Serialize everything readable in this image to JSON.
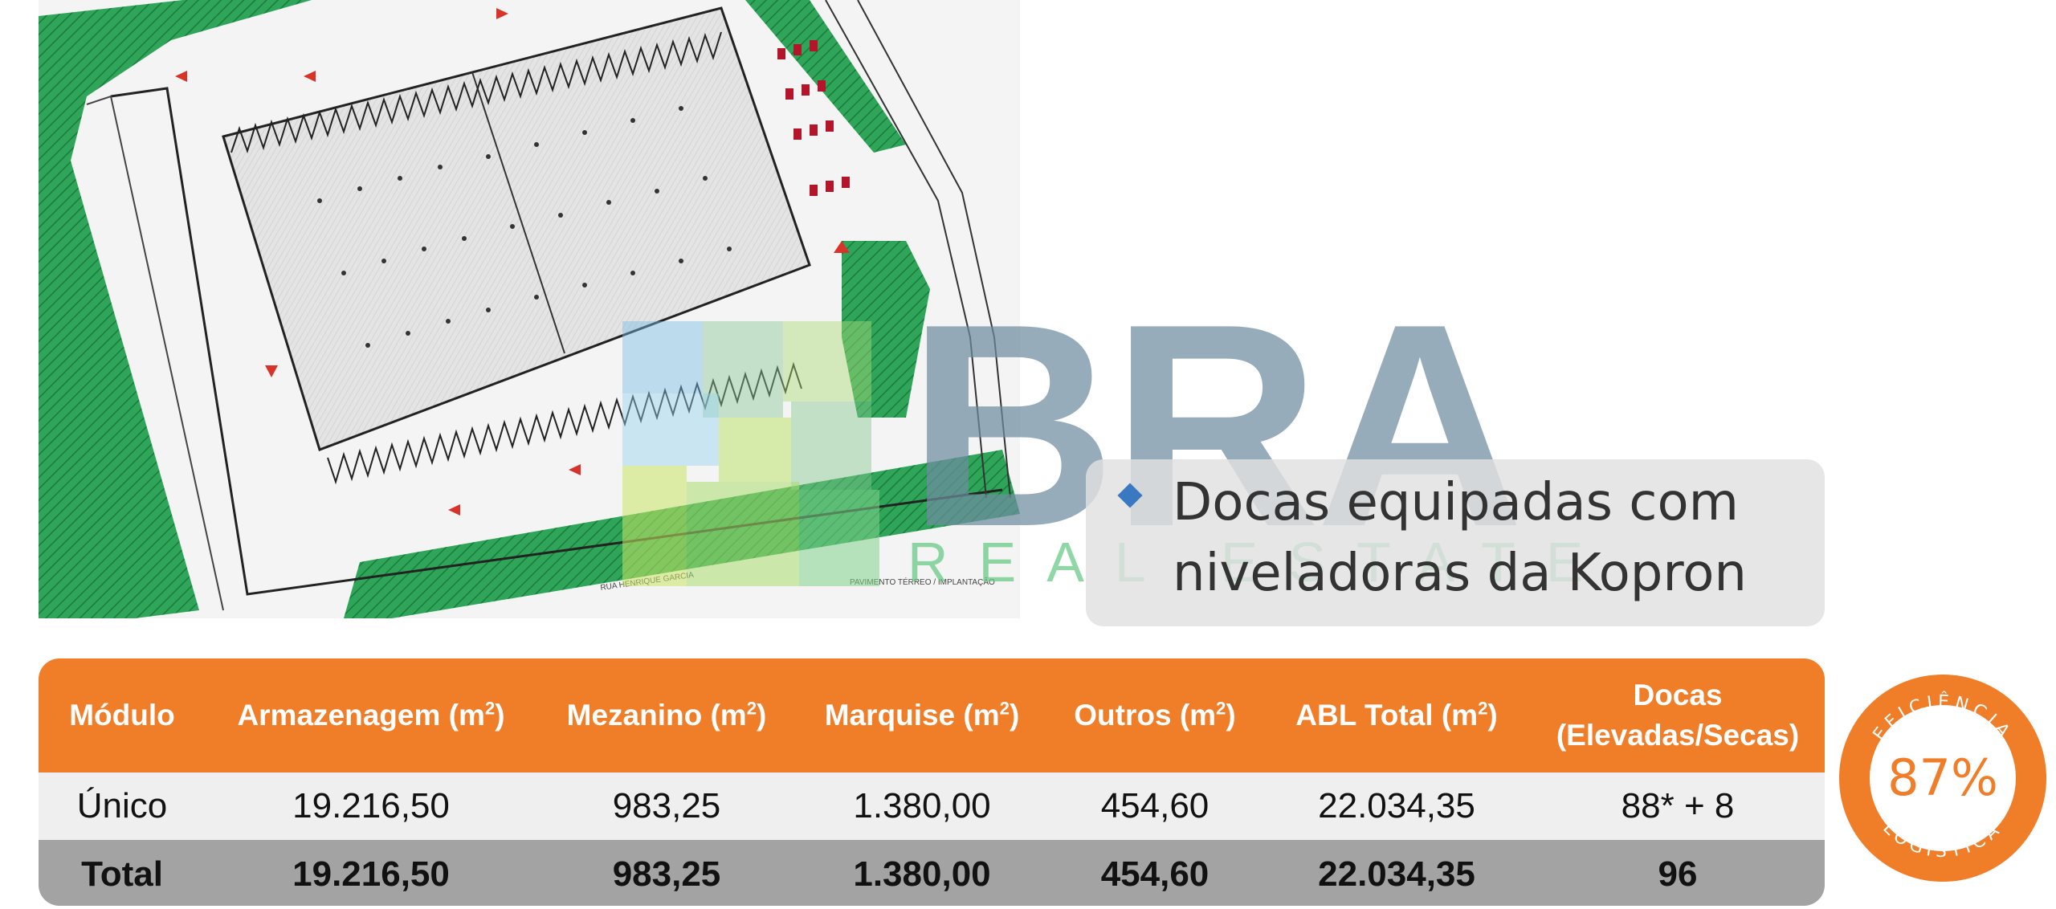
{
  "plan": {
    "street_label": "RUA HENRIQUE GARCIA",
    "caption": "PAVIMENTO TÉRREO / IMPLANTAÇÃO"
  },
  "watermark": {
    "letters": "BRA",
    "sub": "REAL ESTATE"
  },
  "callout": {
    "text": "Docas equipadas com niveladoras da Kopron",
    "bullet_color": "#3a79c2"
  },
  "table": {
    "header_color": "#f07d28",
    "headers": {
      "modulo": "Módulo",
      "armazenagem": "Armazenagem (m",
      "mezanino": "Mezanino (m",
      "marquise": "Marquise (m",
      "outros": "Outros (m",
      "abl": "ABL Total (m",
      "sup": "2",
      "paren": ")",
      "docas_l1": "Docas",
      "docas_l2": "(Elevadas/Secas)"
    },
    "rows": [
      {
        "modulo": "Único",
        "armazenagem": "19.216,50",
        "mezanino": "983,25",
        "marquise": "1.380,00",
        "outros": "454,60",
        "abl": "22.034,35",
        "docas": "88* + 8"
      },
      {
        "modulo": "Total",
        "armazenagem": "19.216,50",
        "mezanino": "983,25",
        "marquise": "1.380,00",
        "outros": "454,60",
        "abl": "22.034,35",
        "docas": "96"
      }
    ]
  },
  "badge": {
    "value": "87%",
    "top_text": "EFICIÊNCIA",
    "bottom_text": "LOGÍSTICA",
    "color": "#f07d28"
  }
}
